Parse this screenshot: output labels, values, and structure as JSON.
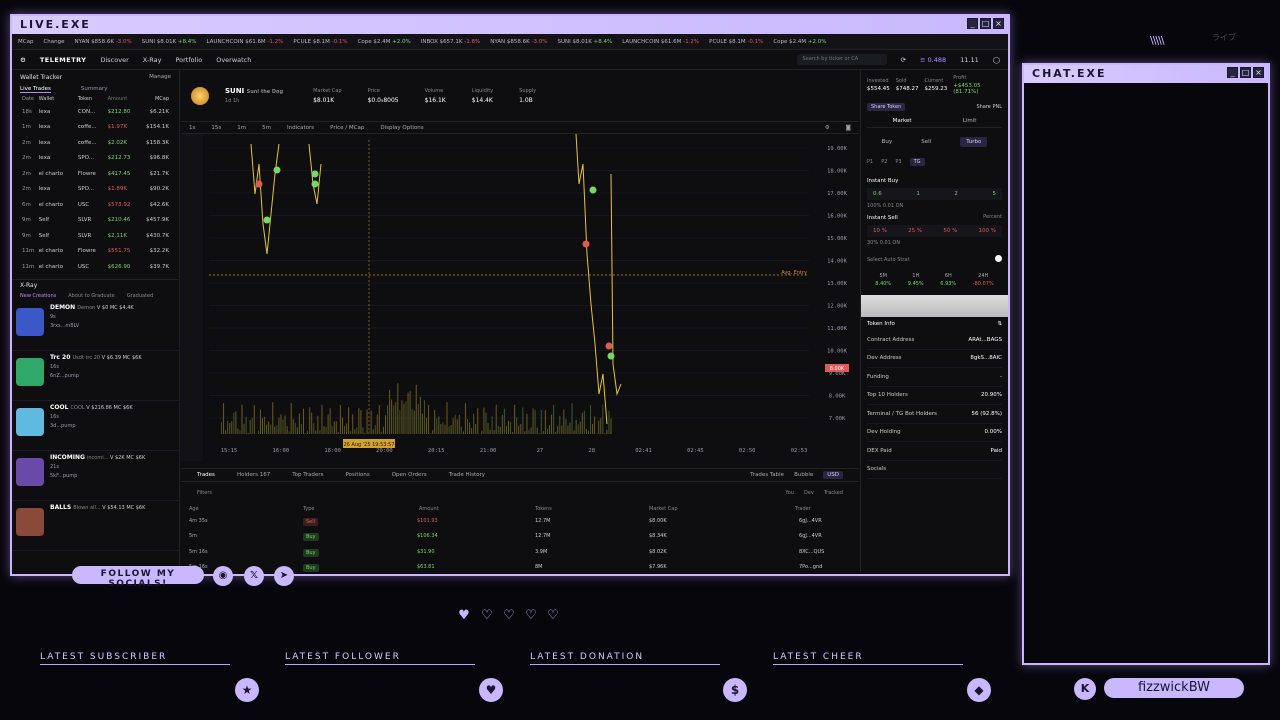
{
  "live_window": {
    "title": "LIVE.EXE"
  },
  "chat_window": {
    "title": "CHAT.EXE"
  },
  "ticker": [
    {
      "name": "MCap",
      "change": ""
    },
    {
      "name": "Change",
      "change": ""
    },
    {
      "name": "NYAN $858.6K",
      "change": "-3.0%",
      "dir": "dn"
    },
    {
      "name": "SUNI $8.01K",
      "change": "+8.4%",
      "dir": "up"
    },
    {
      "name": "LAUNCHCOIN $61.6M",
      "change": "-1.2%",
      "dir": "dn"
    },
    {
      "name": "PCULE $8.1M",
      "change": "-0.1%",
      "dir": "dn"
    },
    {
      "name": "Cope $2.4M",
      "change": "+2.0%",
      "dir": "up"
    },
    {
      "name": "INBOX $657.1K",
      "change": "-1.8%",
      "dir": "dn"
    },
    {
      "name": "NYAN $858.6K",
      "change": "-3.0%",
      "dir": "dn"
    },
    {
      "name": "SUNI $8.01K",
      "change": "+8.4%",
      "dir": "up"
    },
    {
      "name": "LAUNCHCOIN $61.6M",
      "change": "-1.2%",
      "dir": "dn"
    },
    {
      "name": "PCULE $8.1M",
      "change": "-0.1%",
      "dir": "dn"
    },
    {
      "name": "Cope $2.4M",
      "change": "+2.0%",
      "dir": "up"
    }
  ],
  "nav": {
    "logo": "TELEMETRY",
    "items": [
      "Discover",
      "X-Ray",
      "Portfolio",
      "Overwatch"
    ],
    "search_placeholder": "Search by ticker or CA",
    "balance": "0.488",
    "balance2": "11.11"
  },
  "wallet_tracker": {
    "title": "Wallet Tracker",
    "manage": "Manage",
    "tabs": [
      "Live Trades",
      "Summary"
    ],
    "columns": [
      "Date",
      "Wallet",
      "Token",
      "Amount",
      "MCap"
    ],
    "rows": [
      {
        "age": "18s",
        "wallet": "lexa",
        "token": "CON...",
        "amount": "$212.80",
        "mc": "$6.21K",
        "side": "g"
      },
      {
        "age": "1m",
        "wallet": "lexa",
        "token": "coffe...",
        "amount": "$1.97K",
        "mc": "$154.1K",
        "side": "r"
      },
      {
        "age": "2m",
        "wallet": "lexa",
        "token": "coffe...",
        "amount": "$2.02K",
        "mc": "$158.3K",
        "side": "g"
      },
      {
        "age": "2m",
        "wallet": "lexa",
        "token": "SPO...",
        "amount": "$212.73",
        "mc": "$96.8K",
        "side": "g"
      },
      {
        "age": "2m",
        "wallet": "el charto",
        "token": "Flowre",
        "amount": "$417.45",
        "mc": "$21.7K",
        "side": "g"
      },
      {
        "age": "2m",
        "wallet": "lexa",
        "token": "SPO...",
        "amount": "$1.89K",
        "mc": "$90.2K",
        "side": "r"
      },
      {
        "age": "6m",
        "wallet": "el charto",
        "token": "USC",
        "amount": "$573.92",
        "mc": "$42.6K",
        "side": "r"
      },
      {
        "age": "9m",
        "wallet": "Self",
        "token": "SLVR",
        "amount": "$210.46",
        "mc": "$457.9K",
        "side": "g"
      },
      {
        "age": "9m",
        "wallet": "Self",
        "token": "SLVR",
        "amount": "$2.11K",
        "mc": "$430.7K",
        "side": "g"
      },
      {
        "age": "11m",
        "wallet": "el charto",
        "token": "Flowre",
        "amount": "$551.75",
        "mc": "$32.2K",
        "side": "r"
      },
      {
        "age": "11m",
        "wallet": "el charto",
        "token": "USC",
        "amount": "$626.90",
        "mc": "$39.7K",
        "side": "g"
      }
    ]
  },
  "xray": {
    "title": "X-Ray",
    "tabs": [
      "New Creations",
      "About to Graduate",
      "Graduated"
    ],
    "items": [
      {
        "name": "DEMON",
        "sub": "Demon",
        "stats": "V $0  MC $4.4K",
        "line2": "9s",
        "line3": "3rxs...m8LV",
        "color": "#3a58c8"
      },
      {
        "name": "Trc 20",
        "sub": "Usdt trc 20",
        "stats": "V $6.39  MC $6K",
        "line2": "16s",
        "line3": "6nZ...pump",
        "color": "#2fa86a"
      },
      {
        "name": "COOL",
        "sub": "COOL",
        "stats": "V $216.86  MC $6K",
        "line2": "16s",
        "line3": "3d...pump",
        "color": "#5fb9e0"
      },
      {
        "name": "INCOMING",
        "sub": "incomi...",
        "stats": "V $2K  MC $6K",
        "line2": "21s",
        "line3": "5kF...pump",
        "color": "#6a4aa8"
      },
      {
        "name": "BALLS",
        "sub": "Blown all...",
        "stats": "V $54.13  MC $6K",
        "line2": "",
        "line3": "",
        "color": "#8a4a3a"
      }
    ]
  },
  "token": {
    "name": "SUNI",
    "full": "Suni the Dog",
    "age": "1d 1h",
    "stats": [
      {
        "k": "Market Cap",
        "v": "$8.01K"
      },
      {
        "k": "Price",
        "v": "$0.0₅8005"
      },
      {
        "k": "Volume",
        "v": "$16.1K"
      },
      {
        "k": "Liquidity",
        "v": "$14.4K"
      },
      {
        "k": "Supply",
        "v": "1.0B"
      }
    ]
  },
  "chart_tools": {
    "timeframes": [
      "1s",
      "15s",
      "1m",
      "5m"
    ],
    "indicators": "Indicators",
    "price_mcap": "Price / MCap",
    "display": "Display Options"
  },
  "chart": {
    "y_ticks": [
      "19.00K",
      "18.00K",
      "17.00K",
      "16.00K",
      "15.00K",
      "14.00K",
      "13.00K",
      "12.00K",
      "11.00K",
      "10.00K",
      "9.00K",
      "8.00K",
      "7.00K"
    ],
    "x_ticks": [
      "15:15",
      "16:00",
      "18:00",
      "20:00",
      "20:15",
      "21:00",
      "27",
      "28",
      "02:41",
      "02:45",
      "02:50",
      "02:53"
    ],
    "last_value": "8.00K",
    "avg_entry": "Avg. Entry",
    "cursor_time": "26 Aug '25  19:53:57"
  },
  "bottom_tabs": {
    "tabs": [
      "Trades",
      "Holders 167",
      "Top Traders",
      "Positions",
      "Open Orders",
      "Trade History"
    ],
    "right": [
      "Trades Table",
      "Bubble",
      "USD"
    ],
    "filters": "Filters",
    "filter_right": [
      "You",
      "Dev",
      "Tracked"
    ]
  },
  "trades_table": {
    "columns": [
      "Age",
      "Type",
      "Amount",
      "Tokens",
      "Market Cap",
      "Trader"
    ],
    "rows": [
      {
        "age": "4m 35s",
        "type": "Sell",
        "amount": "$101.93",
        "tokens": "12.7M",
        "mc": "$8.00K",
        "trader": "6gJ...4VR"
      },
      {
        "age": "5m",
        "type": "Buy",
        "amount": "$106.34",
        "tokens": "12.7M",
        "mc": "$8.34K",
        "trader": "6gJ...4VR"
      },
      {
        "age": "5m 16s",
        "type": "Buy",
        "amount": "$31.90",
        "tokens": "3.9M",
        "mc": "$8.02K",
        "trader": "8XC...QUS"
      },
      {
        "age": "5m 16s",
        "type": "Buy",
        "amount": "$63.81",
        "tokens": "8M",
        "mc": "$7.96K",
        "trader": "7Po...gnd"
      },
      {
        "age": "5m 16s",
        "type": "Buy",
        "amount": "$42.54",
        "tokens": "5.5M",
        "mc": "$7.79K",
        "trader": "9jS...Jr"
      },
      {
        "age": "5m 16s",
        "type": "Buy",
        "amount": "$85.08",
        "tokens": "11.2M",
        "mc": "$7.59K",
        "trader": "6LH...hhm"
      }
    ]
  },
  "position": {
    "stats": [
      {
        "k": "Invested",
        "v": "$554.45"
      },
      {
        "k": "Sold",
        "v": "$748.27"
      },
      {
        "k": "Current",
        "v": "$259.23"
      },
      {
        "k": "Profit",
        "v": "+$453.05 (81.71%)"
      }
    ],
    "share_token": "Share Token",
    "share_pnl": "Share PNL"
  },
  "trade_panel": {
    "tabs": [
      "Market",
      "Limit"
    ],
    "modes": [
      "Buy",
      "Sell",
      "Turbo"
    ],
    "presets": [
      "P1",
      "P2",
      "P3",
      "TG"
    ],
    "instant_buy": "Instant Buy",
    "buy_amounts": [
      "0.6",
      "1",
      "2",
      "5"
    ],
    "buy_settings": "100%  0.01  ON",
    "instant_sell": "Instant Sell",
    "sell_mode": "Percent",
    "sell_amounts": [
      "10 %",
      "25 %",
      "50 %",
      "100 %"
    ],
    "sell_settings": "30%  0.01  ON",
    "auto_strat": "Select Auto Strat",
    "intervals": [
      {
        "k": "5M",
        "v": "8.40%"
      },
      {
        "k": "1H",
        "v": "9.45%"
      },
      {
        "k": "6H",
        "v": "6.93%"
      },
      {
        "k": "24H",
        "v": "-80.07%"
      }
    ]
  },
  "token_info": {
    "title": "Token Info",
    "rows": [
      {
        "k": "Contract Address",
        "v": "ARAt...BAGS"
      },
      {
        "k": "Dev Address",
        "v": "8gkS...8AIC"
      },
      {
        "k": "Funding",
        "v": "-"
      },
      {
        "k": "Top 10 Holders",
        "v": "20.90%"
      },
      {
        "k": "Terminal / TG Bot Holders",
        "v": "56 (92.8%)"
      },
      {
        "k": "Dev Holding",
        "v": "0.00%"
      },
      {
        "k": "DEX Paid",
        "v": "Paid"
      },
      {
        "k": "Socials",
        "v": ""
      }
    ]
  },
  "overlay": {
    "follow": "FOLLOW MY SOCIALS!",
    "latest": [
      "LATEST SUBSCRIBER",
      "LATEST FOLLOWER",
      "LATEST DONATION",
      "LATEST CHEER"
    ],
    "username": "fizzwickBW",
    "jp": "ライブ"
  },
  "colors": {
    "accent": "#c9b8ff",
    "up": "#7bd66a",
    "down": "#e05a5a",
    "chart_line": "#e6c43a"
  }
}
